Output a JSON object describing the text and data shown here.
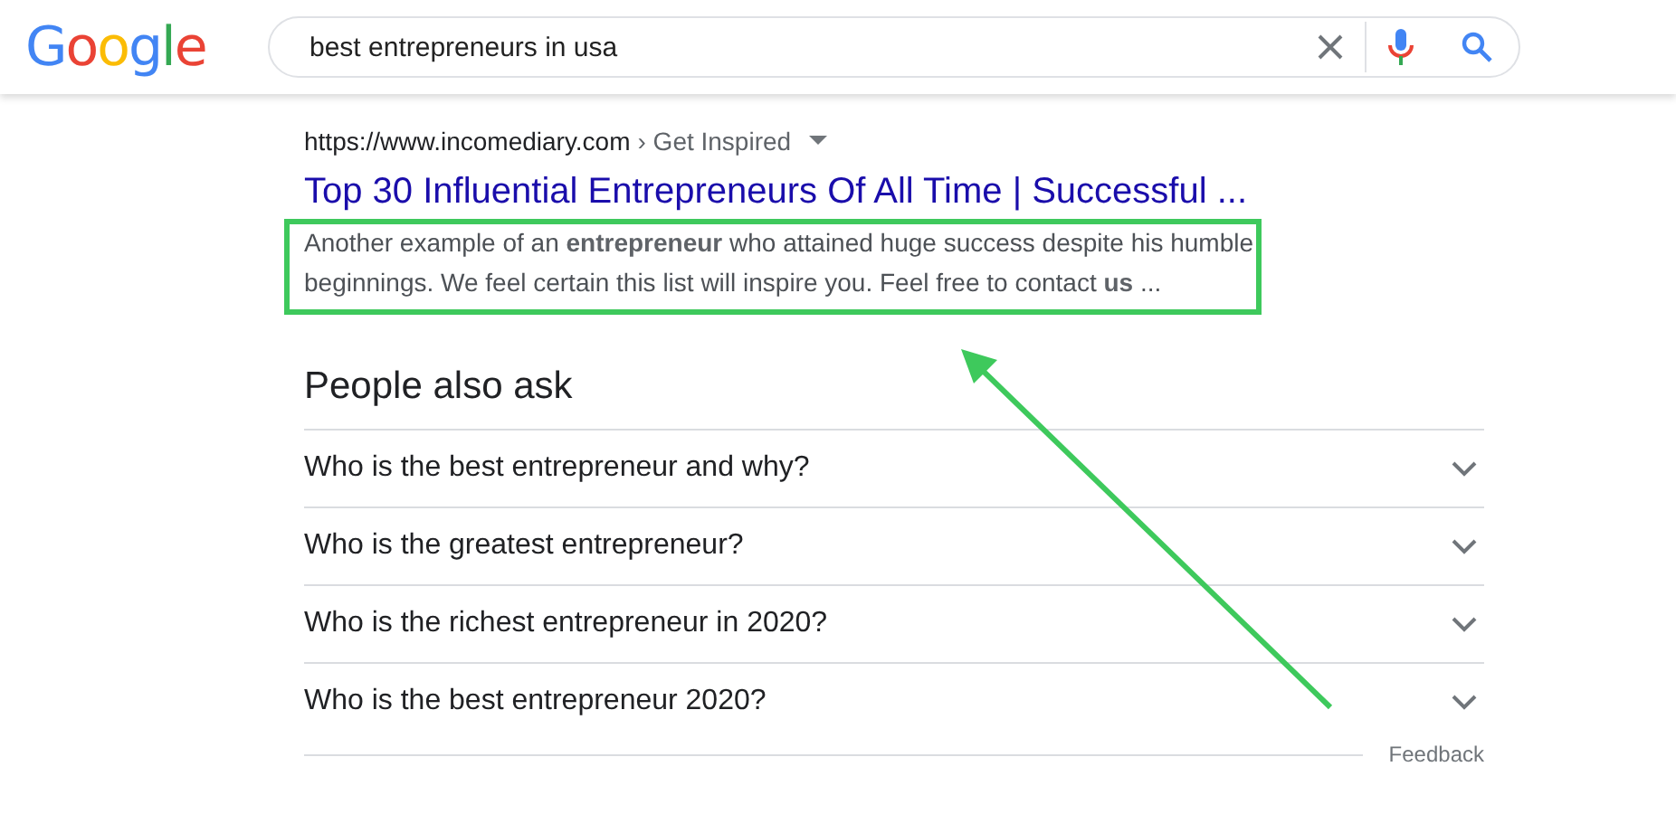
{
  "logo": "Google",
  "search": {
    "value": "best entrepreneurs in usa"
  },
  "result": {
    "url": "https://www.incomediary.com",
    "breadcrumb": "› Get Inspired",
    "title": "Top 30 Influential Entrepreneurs Of All Time | Successful ...",
    "snippet": "Another example of an **entrepreneur** who attained huge success despite his humble beginnings. We feel certain this list will inspire you. Feel free to contact **us** ..."
  },
  "people_also_ask": {
    "heading": "People also ask",
    "questions": [
      {
        "text": "Who is the best entrepreneur and why?",
        "expanded": false
      },
      {
        "text": "Who is the greatest entrepreneur?",
        "expanded": false
      },
      {
        "text": "Who is the richest entrepreneur in 2020?",
        "expanded": false
      },
      {
        "text": "Who is the best entrepreneur 2020?",
        "expanded": false
      }
    ],
    "feedback": "Feedback"
  },
  "highlight": {
    "color": "#3ec95c"
  },
  "arrow": {
    "color": "#3ec95c"
  }
}
